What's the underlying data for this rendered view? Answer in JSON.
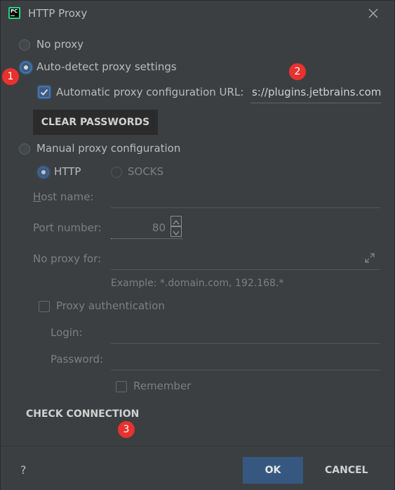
{
  "window": {
    "title": "HTTP Proxy",
    "app_icon_text": "PC"
  },
  "options": {
    "no_proxy": "No proxy",
    "auto_detect": "Auto-detect proxy settings",
    "auto_config_url_label": "Automatic proxy configuration URL:",
    "auto_config_url_value": "s://plugins.jetbrains.com",
    "clear_passwords": "CLEAR PASSWORDS",
    "manual": "Manual proxy configuration",
    "http": "HTTP",
    "socks": "SOCKS",
    "host_name_label": "Host name:",
    "port_number_label": "Port number:",
    "port_value": "80",
    "no_proxy_for_label": "No proxy for:",
    "example": "Example: *.domain.com, 192.168.*",
    "proxy_auth": "Proxy authentication",
    "login_label": "Login:",
    "password_label": "Password:",
    "remember": "Remember",
    "check_connection": "CHECK CONNECTION"
  },
  "badges": [
    "1",
    "2",
    "3"
  ],
  "footer": {
    "help": "?",
    "ok": "OK",
    "cancel": "CANCEL"
  },
  "colors": {
    "background": "#3c3f41",
    "accent": "#365880",
    "badge": "#e8322f"
  },
  "icons": {
    "close": "close-icon",
    "expand": "expand-icon"
  }
}
